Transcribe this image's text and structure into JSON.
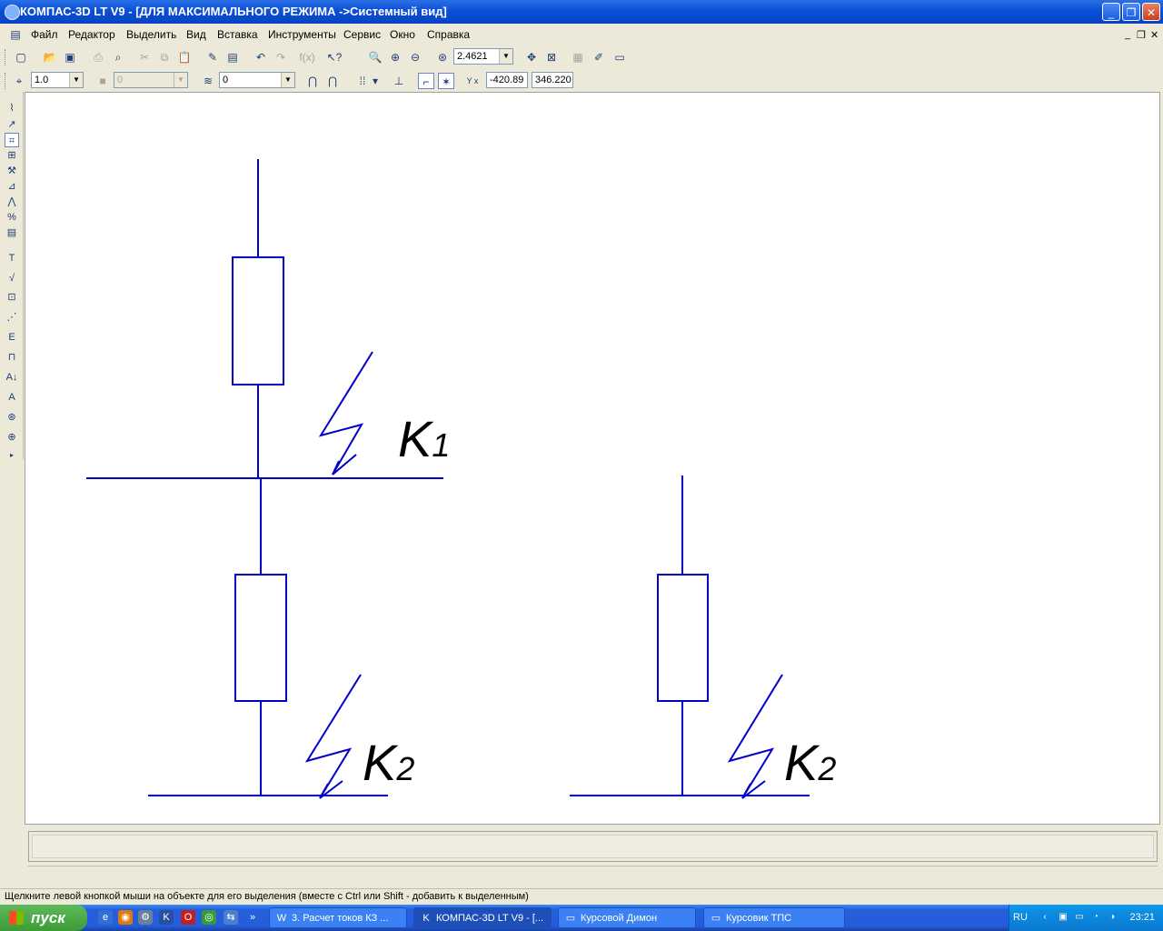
{
  "window": {
    "title": "КОМПАС-3D LT V9 - [ДЛЯ МАКСИМАЛЬНОГО РЕЖИМА ->Системный вид]",
    "buttons": {
      "minimize": "_",
      "maximize": "❐",
      "close": "✕"
    }
  },
  "menu": {
    "items": [
      "Файл",
      "Редактор",
      "Выделить",
      "Вид",
      "Вставка",
      "Инструменты",
      "Сервис",
      "Окно",
      "Справка"
    ],
    "doc_controls": [
      "_",
      "❐",
      "✕"
    ]
  },
  "toolbar1": {
    "zoom_value": "2.4621",
    "icons": [
      "new-icon",
      "open-icon",
      "save-icon",
      "print-icon",
      "preview-icon",
      "cut-icon",
      "copy-icon",
      "paste-icon",
      "properties-icon",
      "library-icon",
      "undo-icon",
      "redo-icon",
      "formula-icon",
      "help-pointer-icon",
      "zoom-window-icon",
      "zoom-in-icon",
      "zoom-out-icon",
      "zoom-scale-icon",
      "pan-icon",
      "zoom-all-icon",
      "layers-icon",
      "brush-icon",
      "view-icon"
    ]
  },
  "toolbar2": {
    "line_scale": "1.0",
    "style_value": "0",
    "layer_value": "0",
    "coord_label": "Y x",
    "coord_x": "-420.89",
    "coord_y": "346.220"
  },
  "drawing": {
    "labels": [
      {
        "main": "K",
        "sub": "1"
      },
      {
        "main": "K",
        "sub": "2"
      },
      {
        "main": "K",
        "sub": "2"
      }
    ],
    "line_color": "#0000c8"
  },
  "statusbar": {
    "text": "Щелкните левой кнопкой мыши на объекте для его выделения (вместе с Ctrl или Shift - добавить к выделенным)"
  },
  "taskbar": {
    "start_label": "пуск",
    "tasks": [
      {
        "label": "3. Расчет токов КЗ ...",
        "icon": "W"
      },
      {
        "label": "КОМПАС-3D LT V9 - [...",
        "icon": "K"
      },
      {
        "label": "Курсовой Димон",
        "icon": "▭"
      },
      {
        "label": "Курсовик ТПС",
        "icon": "▭"
      }
    ],
    "lang": "RU",
    "clock": "23:21"
  }
}
